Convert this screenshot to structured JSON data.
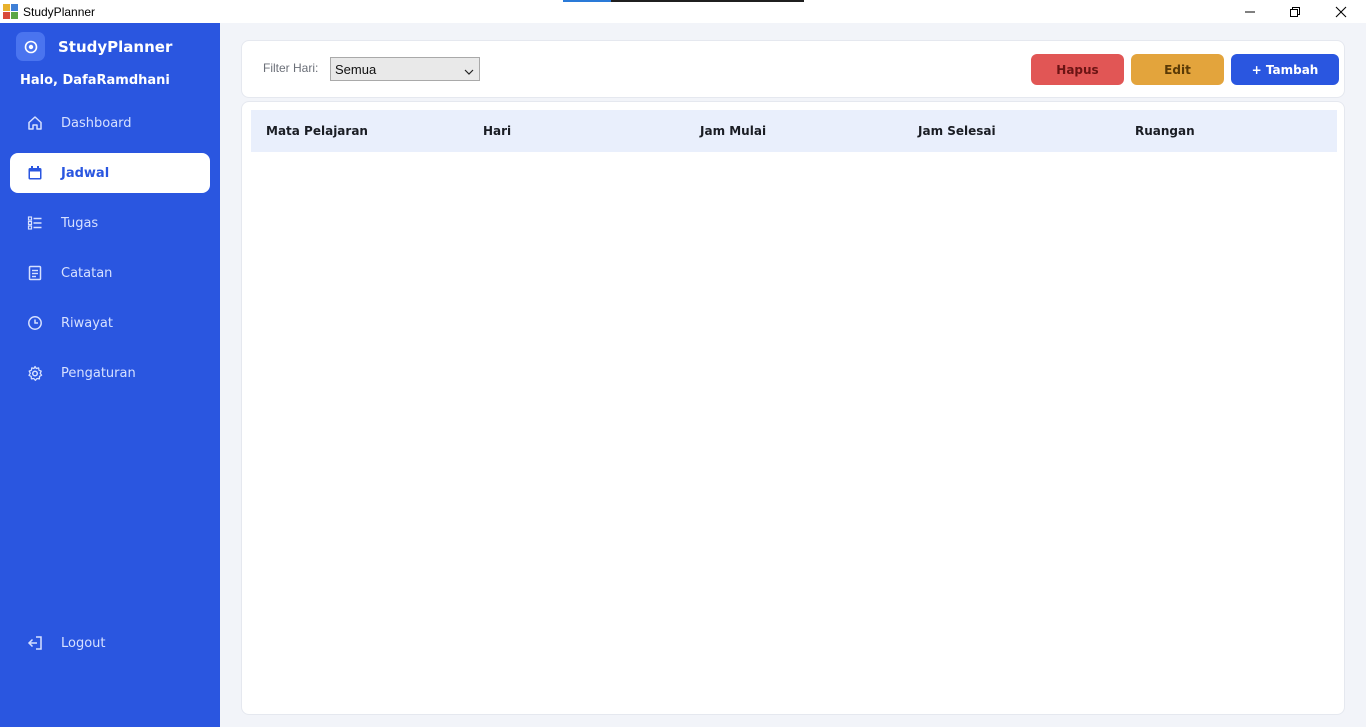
{
  "window": {
    "title": "StudyPlanner",
    "progress": 0.2,
    "icons": {
      "minimize": "minimize-icon",
      "maximize": "restore-icon",
      "close": "close-icon"
    }
  },
  "sidebar": {
    "brand": "StudyPlanner",
    "greeting": "Halo, DafaRamdhani",
    "items": [
      {
        "label": "Dashboard",
        "icon": "home-icon"
      },
      {
        "label": "Jadwal",
        "icon": "calendar-icon",
        "active": true
      },
      {
        "label": "Tugas",
        "icon": "task-list-icon"
      },
      {
        "label": "Catatan",
        "icon": "notes-icon"
      },
      {
        "label": "Riwayat",
        "icon": "clock-icon"
      },
      {
        "label": "Pengaturan",
        "icon": "gear-icon"
      }
    ],
    "logout": {
      "label": "Logout",
      "icon": "logout-icon"
    }
  },
  "toolbar": {
    "filter_label": "Filter Hari:",
    "filter_value": "Semua",
    "delete_label": "Hapus",
    "edit_label": "Edit",
    "add_label": "+ Tambah"
  },
  "table": {
    "columns": [
      "Mata Pelajaran",
      "Hari",
      "Jam Mulai",
      "Jam Selesai",
      "Ruangan"
    ],
    "rows": []
  },
  "colors": {
    "accent": "#2a56e0",
    "delete": "#e15655",
    "edit": "#e3a43c",
    "table_header": "#e9effc"
  }
}
